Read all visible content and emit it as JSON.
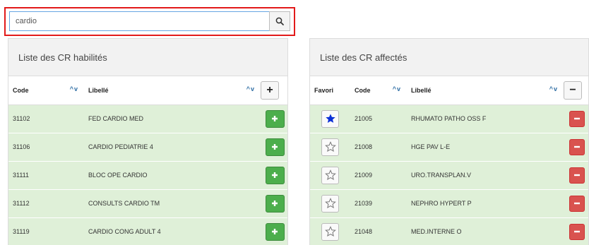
{
  "search": {
    "value": "cardio",
    "button_icon": "search-icon"
  },
  "left_panel": {
    "title": "Liste des CR habilités",
    "columns": {
      "code": "Code",
      "libelle": "Libellé",
      "sort_indicator": "^v"
    },
    "add_all_label": "+",
    "rows": [
      {
        "code": "31102",
        "libelle": "FED CARDIO MED"
      },
      {
        "code": "31106",
        "libelle": "CARDIO PEDIATRIE 4"
      },
      {
        "code": "31111",
        "libelle": "BLOC OPE CARDIO"
      },
      {
        "code": "31112",
        "libelle": "CONSULTS CARDIO TM"
      },
      {
        "code": "31119",
        "libelle": "CARDIO CONG ADULT 4"
      }
    ]
  },
  "right_panel": {
    "title": "Liste des CR affectés",
    "columns": {
      "favori": "Favori",
      "code": "Code",
      "libelle": "Libellé",
      "sort_indicator": "^v"
    },
    "remove_all_label": "−",
    "rows": [
      {
        "favorite": true,
        "code": "21005",
        "libelle": "RHUMATO PATHO OSS F"
      },
      {
        "favorite": false,
        "code": "21008",
        "libelle": "HGE PAV L-E"
      },
      {
        "favorite": false,
        "code": "21009",
        "libelle": "URO.TRANSPLAN.V"
      },
      {
        "favorite": false,
        "code": "21039",
        "libelle": "NEPHRO HYPERT P"
      },
      {
        "favorite": false,
        "code": "21048",
        "libelle": "MED.INTERNE O"
      }
    ]
  },
  "colors": {
    "row_bg": "#dff0d8",
    "add_green": "#4cae4c",
    "remove_red": "#d9534f",
    "star_blue": "#0b2fd6",
    "highlight_red": "#e21a1a",
    "sort_blue": "#2e6da4"
  }
}
